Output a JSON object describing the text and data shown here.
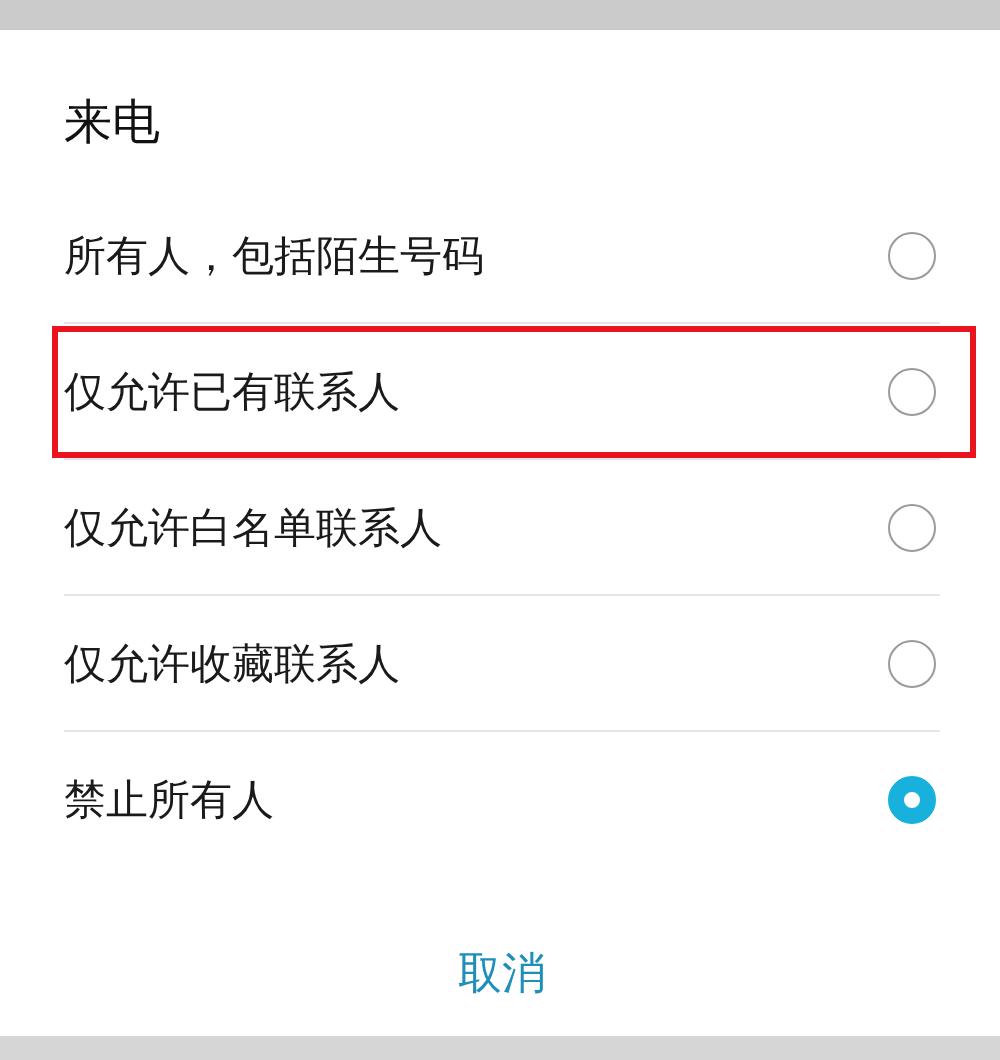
{
  "dialog": {
    "title": "来电",
    "options": [
      {
        "label": "所有人，包括陌生号码",
        "selected": false,
        "highlighted": false
      },
      {
        "label": "仅允许已有联系人",
        "selected": false,
        "highlighted": true
      },
      {
        "label": "仅允许白名单联系人",
        "selected": false,
        "highlighted": false
      },
      {
        "label": "仅允许收藏联系人",
        "selected": false,
        "highlighted": false
      },
      {
        "label": "禁止所有人",
        "selected": true,
        "highlighted": false
      }
    ],
    "buttons": [
      "取消"
    ]
  }
}
